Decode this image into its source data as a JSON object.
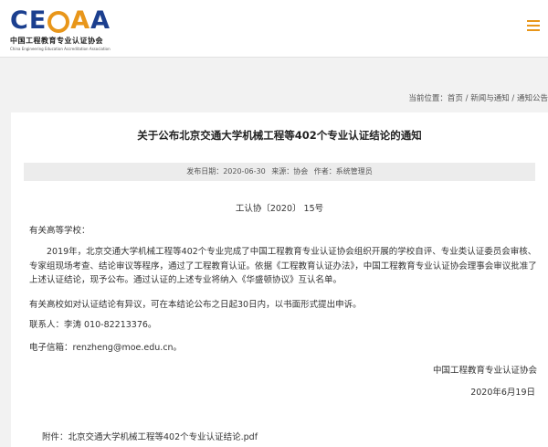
{
  "header": {
    "logo_mark": "CEEAA",
    "logo_cn": "中国工程教育专业认证协会",
    "logo_en": "China Engineering Education Accreditation Association",
    "brand_blue": "#1b3f8f",
    "brand_orange": "#e8961a",
    "menu_icon": "hamburger-menu-icon"
  },
  "breadcrumb": {
    "prefix": "当前位置：",
    "home": "首页",
    "sep": " / ",
    "section": "新闻与通知",
    "page": "通知公告"
  },
  "article": {
    "title": "关于公布北京交通大学机械工程等402个专业认证结论的通知",
    "meta": {
      "date": "发布日期：2020-06-30",
      "source": "来源：协会",
      "author": "作者：系统管理员"
    },
    "doc_number": "工认协〔2020〕 15号",
    "salutation": "有关高等学校：",
    "paragraphs": [
      "2019年，北京交通大学机械工程等402个专业完成了中国工程教育专业认证协会组织开展的学校自评、专业类认证委员会审核、专家组现场考查、结论审议等程序，通过了工程教育认证。依据《工程教育认证办法》，中国工程教育专业认证协会理事会审议批准了上述认证结论，现予公布。通过认证的上述专业将纳入《华盛顿协议》互认名单。",
      "有关高校如对认证结论有异议，可在本结论公布之日起30日内，以书面形式提出申诉。",
      "联系人：李涛 010-82213376。",
      "电子信箱：renzheng@moe.edu.cn。"
    ],
    "signature_org": "中国工程教育专业认证协会",
    "signature_date": "2020年6月19日",
    "attachment": "附件：北京交通大学机械工程等402个专业认证结论.pdf"
  }
}
